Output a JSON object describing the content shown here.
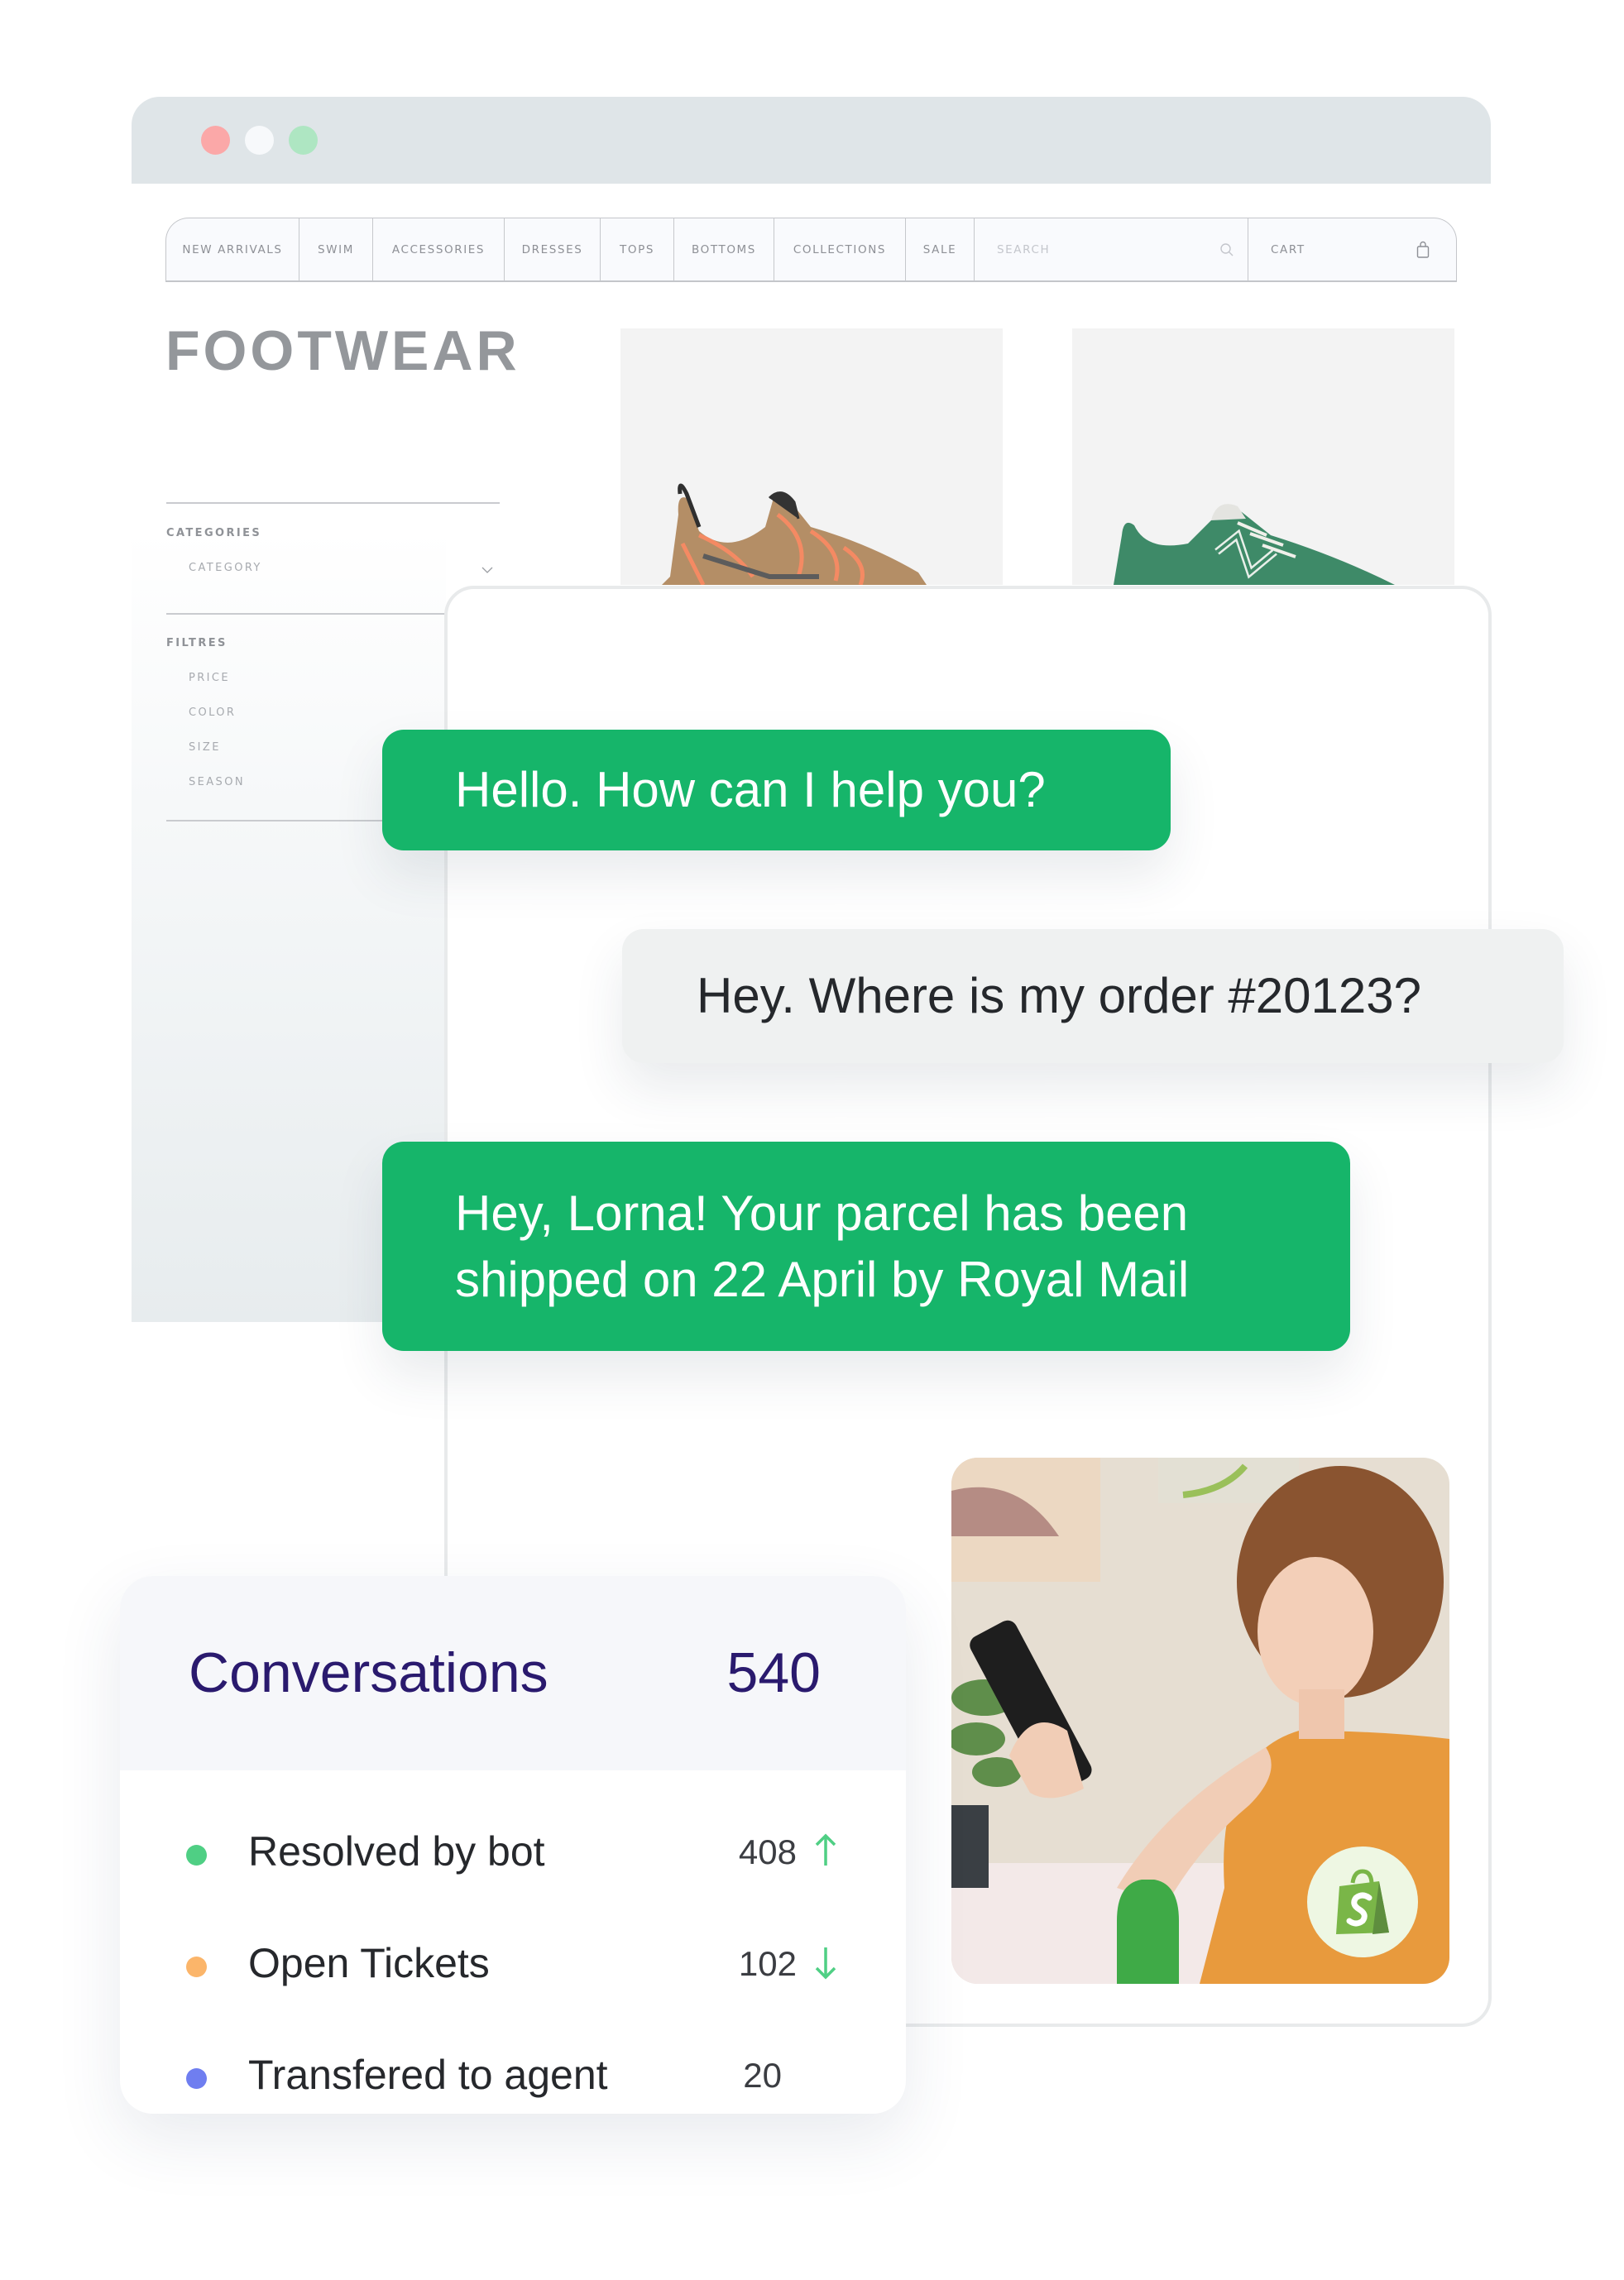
{
  "browser": {
    "window_controls": [
      "close",
      "minimize",
      "maximize"
    ],
    "nav": {
      "items": [
        "NEW ARRIVALS",
        "SWIM",
        "ACCESSORIES",
        "DRESSES",
        "TOPS",
        "BOTTOMS",
        "COLLECTIONS",
        "SALE"
      ],
      "search_placeholder": "SEARCH",
      "search_icon": "search-icon",
      "cart_label": "CART",
      "cart_icon": "shopping-bag-icon"
    },
    "page_title": "FOOTWEAR",
    "sidebar": {
      "categories_label": "CATEGORIES",
      "category_select": "CATEGORY",
      "filters_label": "FILTRES",
      "filters": [
        "PRICE",
        "COLOR",
        "SIZE",
        "SEASON"
      ]
    },
    "products": [
      {
        "image": "orange-tan-hiking-sneaker"
      },
      {
        "image": "green-new-balance-sneaker"
      }
    ]
  },
  "chat": {
    "messages": [
      {
        "from": "bot",
        "text": "Hello. How can I help you?"
      },
      {
        "from": "user",
        "text": "Hey. Where is my order #20123?"
      },
      {
        "from": "bot",
        "lines": [
          "Hey, Lorna! Your parcel has been",
          "shipped on 22 April by Royal Mail"
        ]
      }
    ],
    "photo": {
      "subject": "woman-looking-at-phone",
      "badge": "shopify-logo"
    }
  },
  "stats": {
    "title": "Conversations",
    "total": "540",
    "rows": [
      {
        "label": "Resolved by bot",
        "value": "408",
        "trend": "up",
        "color": "#4fcf84"
      },
      {
        "label": "Open Tickets",
        "value": "102",
        "trend": "down",
        "color": "#fbb56a"
      },
      {
        "label": "Transfered to agent",
        "value": "20",
        "trend": "",
        "color": "#6f7ef0"
      }
    ]
  },
  "colors": {
    "bot_bubble": "#16b56a",
    "user_bubble": "#eff1f1",
    "stats_heading": "#2a1a6e",
    "trend_arrow": "#4fcf84"
  }
}
